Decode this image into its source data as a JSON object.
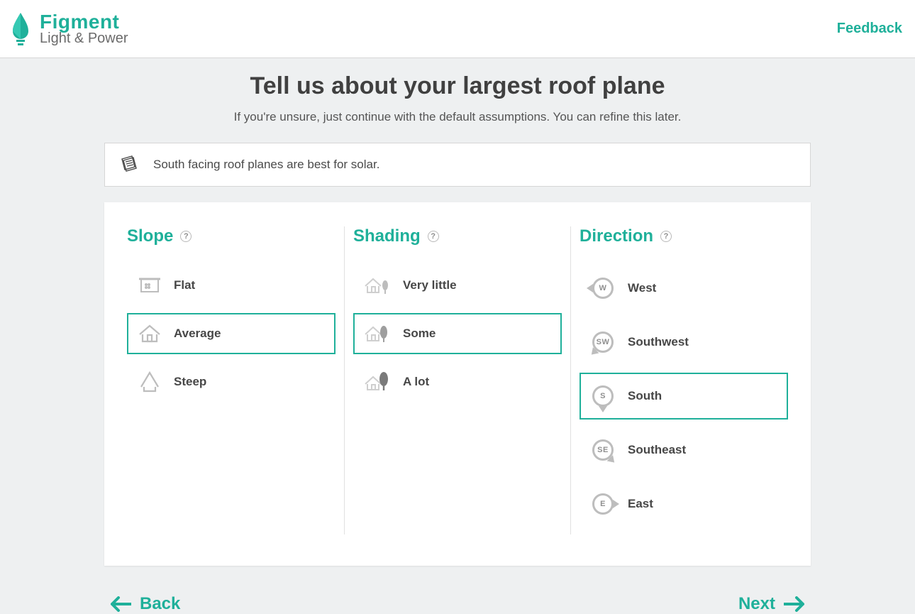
{
  "brand": {
    "name": "Figment",
    "sub": "Light & Power"
  },
  "header": {
    "feedback": "Feedback"
  },
  "page": {
    "title": "Tell us about your largest roof plane",
    "subtitle": "If you're unsure, just continue with the default assumptions. You can refine this later.",
    "tip": "South facing roof planes are best for solar."
  },
  "columns": {
    "slope": {
      "title": "Slope",
      "options": [
        {
          "label": "Flat"
        },
        {
          "label": "Average"
        },
        {
          "label": "Steep"
        }
      ],
      "selected": 1
    },
    "shading": {
      "title": "Shading",
      "options": [
        {
          "label": "Very little"
        },
        {
          "label": "Some"
        },
        {
          "label": "A lot"
        }
      ],
      "selected": 1
    },
    "direction": {
      "title": "Direction",
      "options": [
        {
          "label": "West",
          "code": "W",
          "dir": "w"
        },
        {
          "label": "Southwest",
          "code": "SW",
          "dir": "sw"
        },
        {
          "label": "South",
          "code": "S",
          "dir": "s"
        },
        {
          "label": "Southeast",
          "code": "SE",
          "dir": "se"
        },
        {
          "label": "East",
          "code": "E",
          "dir": "e"
        }
      ],
      "selected": 2
    }
  },
  "nav": {
    "back": "Back",
    "next": "Next"
  }
}
